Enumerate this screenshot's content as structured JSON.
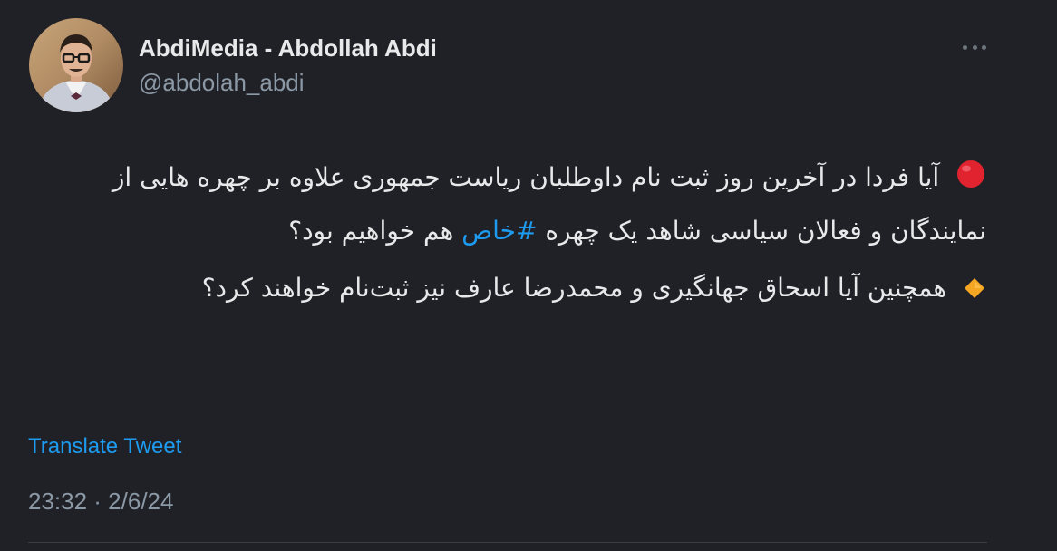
{
  "author": {
    "display_name": "AbdiMedia - Abdollah Abdi",
    "handle": "@abdolah_abdi",
    "avatar_icon": "profile-photo"
  },
  "menu": {
    "icon": "more-horizontal-icon"
  },
  "tweet": {
    "paragraph1": {
      "emoji": "red-circle",
      "text_before": "آیا فردا در آخرین روز ثبت نام داوطلبان ریاست جمهوری علاوه بر چهره هایی از نمایندگان و فعالان سیاسی شاهد یک چهره ",
      "hashtag": "#خاص",
      "text_after": " هم خواهیم بود؟"
    },
    "paragraph2": {
      "emoji": "orange-diamond",
      "text": "همچنین آیا اسحاق جهانگیری و محمدرضا عارف نیز ثبت‌نام خواهند کرد؟"
    }
  },
  "translate_label": "Translate Tweet",
  "timestamp": "23:32 · 2/6/24",
  "colors": {
    "background": "#202126",
    "text": "#e7e9ea",
    "muted": "#8b98a5",
    "link": "#1d9bf0",
    "red_circle": "#e0232e",
    "orange_diamond": "#f5a623"
  }
}
